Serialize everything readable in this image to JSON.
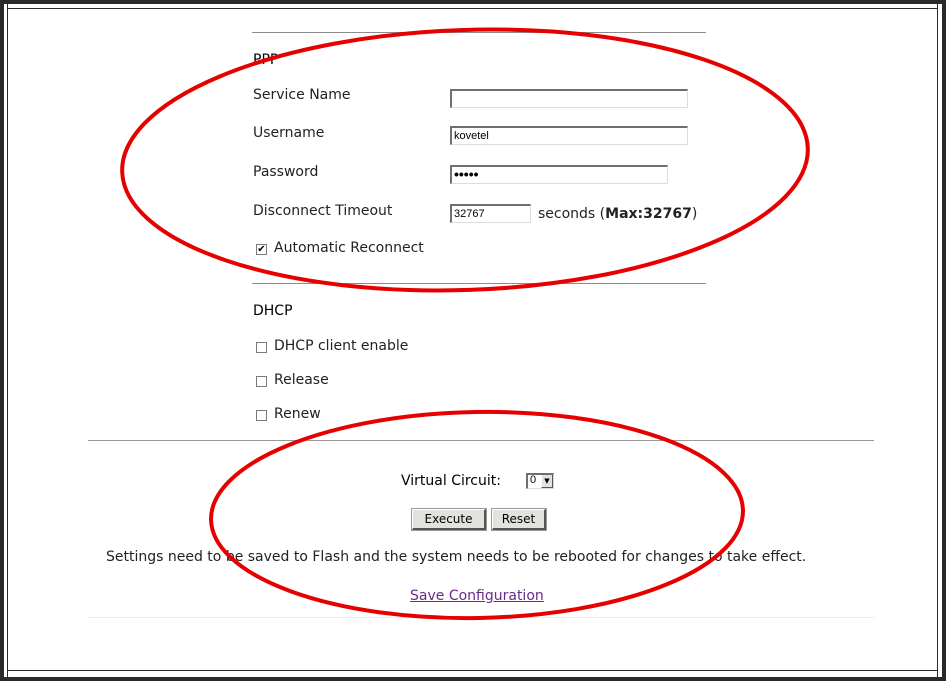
{
  "ppp": {
    "title": "PPP",
    "service_name_label": "Service Name",
    "service_name_value": "",
    "username_label": "Username",
    "username_value": "kovetel",
    "password_label": "Password",
    "password_masked": "•••••",
    "timeout_label": "Disconnect Timeout",
    "timeout_value": "32767",
    "timeout_unit": "seconds (",
    "timeout_max": "Max:32767",
    "timeout_close": ")",
    "auto_reconnect_label": "Automatic Reconnect",
    "auto_reconnect_checked": true
  },
  "dhcp": {
    "title": "DHCP",
    "client_enable_label": "DHCP client enable",
    "release_label": "Release",
    "renew_label": "Renew"
  },
  "vc": {
    "label": "Virtual Circuit:",
    "value": "0"
  },
  "actions": {
    "execute_label": "Execute",
    "reset_label": "Reset"
  },
  "footer": {
    "notice": "Settings need to be saved to Flash and the system needs to be rebooted for changes to take effect.",
    "save_link": "Save Configuration"
  },
  "annotation": {
    "color": "#e60000"
  },
  "icons": {
    "dropdown": "chevron-down-icon",
    "check": "checkmark-icon"
  }
}
